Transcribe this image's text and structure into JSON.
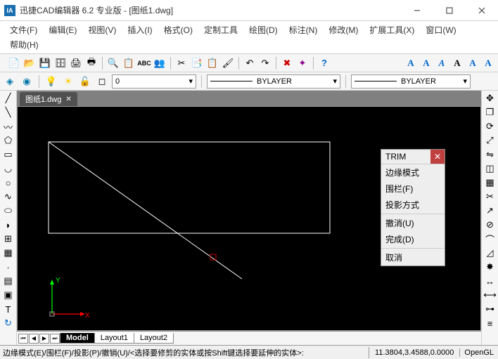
{
  "window": {
    "title": "迅捷CAD编辑器 6.2 专业版  - [图纸1.dwg]",
    "app_icon_text": "IA"
  },
  "menu": [
    "文件(F)",
    "编辑(E)",
    "视图(V)",
    "插入(I)",
    "格式(O)",
    "定制工具",
    "绘图(D)",
    "标注(N)",
    "修改(M)",
    "扩展工具(X)",
    "窗口(W)",
    "帮助(H)"
  ],
  "toolbar1": {
    "text_group": [
      "A",
      "A",
      "A",
      "A",
      "A",
      "A"
    ]
  },
  "props": {
    "layer_combo": "0",
    "lt_combo": "BYLAYER",
    "lw_combo": "BYLAYER"
  },
  "doc_tab": {
    "label": "图纸1.dwg",
    "close": "✕"
  },
  "ucs_labels": {
    "x": "X",
    "y": "Y"
  },
  "context": {
    "title": "TRIM",
    "items_a": [
      "边缘模式",
      "围栏(F)",
      "投影方式"
    ],
    "items_b": [
      "撤消(U)",
      "完成(D)"
    ],
    "items_c": [
      "取消"
    ]
  },
  "layouts": {
    "nav": [
      "⏮",
      "◀",
      "▶",
      "⏭"
    ],
    "tabs": [
      "Model",
      "Layout1",
      "Layout2"
    ]
  },
  "status": {
    "command": "边缘模式(E)/围栏(F)/投影(P)/撤销(U)/<选择要修剪的实体或按Shift键选择要延伸的实体>:",
    "coords": "11.3804,3.4588,0.0000",
    "renderer": "OpenGL"
  }
}
